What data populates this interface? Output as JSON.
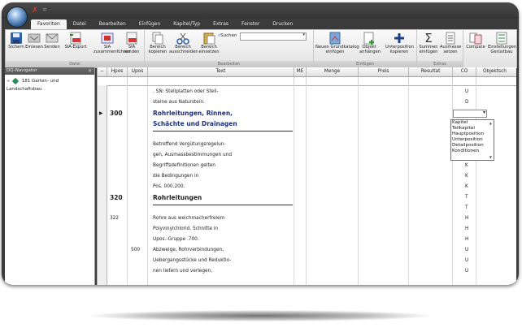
{
  "window": {
    "title_text": "",
    "quick_access": [
      "✗",
      "="
    ]
  },
  "tabs": [
    "Favoriten",
    "Datei",
    "Bearbeiten",
    "Einfügen",
    "Kapitel/Typ",
    "Extras",
    "Fenster",
    "Drucken"
  ],
  "ribbon": {
    "groups": {
      "datei": "Datei",
      "bearbeiten": "Bearbeiten",
      "einfuegen": "Einfügen",
      "extras": "Extras"
    },
    "buttons": {
      "sichern": "Sichern",
      "einlesen": "Einlesen",
      "senden": "Senden",
      "sia_export": "SIA-Export",
      "sia_zusammen_1": "SIA",
      "sia_zusammen_2": "zusammenführen",
      "sia_senden_1": "SIA",
      "sia_senden_2": "senden",
      "bereich_kop_1": "Bereich",
      "bereich_kop_2": "kopieren",
      "bereich_aus_1": "Bereich",
      "bereich_aus_2": "ausschneiden",
      "bereich_ein_1": "Bereich",
      "bereich_ein_2": "einsetzen",
      "suchen": "Suchen",
      "neuen_gk_1": "Neuen Grundkatalog",
      "neuen_gk_2": "einfügen",
      "objekt_1": "Objekt",
      "objekt_2": "anhängen",
      "unterpos_1": "Unterposition",
      "unterpos_2": "kopieren",
      "summen_1": "Summen",
      "summen_2": "einfügen",
      "ausmasse_1": "Ausmasse",
      "ausmasse_2": "setzen",
      "compare": "Compare",
      "einstellungen_1": "Einstellungen",
      "einstellungen_2": "Gerüstbau"
    },
    "search_value": ""
  },
  "navigator": {
    "title": "DQ-Navigator",
    "close": "×",
    "items": [
      {
        "expander": "+",
        "label": "181 Garten- und Landschaftsbau"
      }
    ]
  },
  "grid": {
    "columns": [
      "−",
      "Hpos",
      "Upos",
      "Text",
      "ME",
      "Menge",
      "Preis",
      "Resultat",
      "CO",
      "Objektsch"
    ],
    "rows": [
      {
        "hpos": "",
        "upos": "",
        "text": ". SN: Stellplatten oder Stell-",
        "co": "U",
        "style": "normal"
      },
      {
        "hpos": "",
        "upos": "",
        "text": "steine aus Naturstein.",
        "co": "D",
        "style": "normal"
      },
      {
        "hpos": "300",
        "upos": "",
        "text": "Rohrleitungen, Rinnen,",
        "co": "",
        "style": "title-blue",
        "marker": "▶"
      },
      {
        "hpos": "",
        "upos": "",
        "text": "Schächte und Drainagen",
        "co": "",
        "style": "title-blue"
      },
      {
        "hpos": "",
        "upos": "",
        "text": "",
        "co": "",
        "style": "normal"
      },
      {
        "hpos": "",
        "upos": "",
        "text": "Betreffend Vergütungsregelun-",
        "co": "",
        "style": "normal"
      },
      {
        "hpos": "",
        "upos": "",
        "text": "gen, Ausmassbestimmungen und",
        "co": "",
        "style": "normal"
      },
      {
        "hpos": "",
        "upos": "",
        "text": "Begriffsdefinitionen gelten",
        "co": "K",
        "style": "normal"
      },
      {
        "hpos": "",
        "upos": "",
        "text": "die Bedingungen in",
        "co": "K",
        "style": "normal"
      },
      {
        "hpos": "",
        "upos": "",
        "text": "Pos. 000.200.",
        "co": "K",
        "style": "normal"
      },
      {
        "hpos": "320",
        "upos": "",
        "text": "Rohrleitungen",
        "co": "T",
        "style": "title-black"
      },
      {
        "hpos": "",
        "upos": "",
        "text": "",
        "co": "T",
        "style": "normal"
      },
      {
        "hpos": "322",
        "upos": "",
        "text": "Rohre aus weichmacherfreiem",
        "co": "H",
        "style": "normal"
      },
      {
        "hpos": "",
        "upos": "",
        "text": "Polyvinylchlorid. Schnitte in",
        "co": "H",
        "style": "normal"
      },
      {
        "hpos": "",
        "upos": "",
        "text": "Upos.-Gruppe .700.",
        "co": "H",
        "style": "normal"
      },
      {
        "hpos": "",
        "upos": "500",
        "text": "Abzweige, Rohrverbindungen,",
        "co": "U",
        "style": "normal"
      },
      {
        "hpos": "",
        "upos": "",
        "text": "Uebergangsstücke und Reduktio-",
        "co": "U",
        "style": "normal"
      },
      {
        "hpos": "",
        "upos": "",
        "text": "nen liefern und verlegen,",
        "co": "U",
        "style": "normal"
      }
    ],
    "co_dropdown": {
      "options": [
        "Kapitel",
        "Teilkapitel",
        "Hauptposition",
        "Unterposition",
        "Detailposition",
        "Konditionen"
      ]
    }
  }
}
